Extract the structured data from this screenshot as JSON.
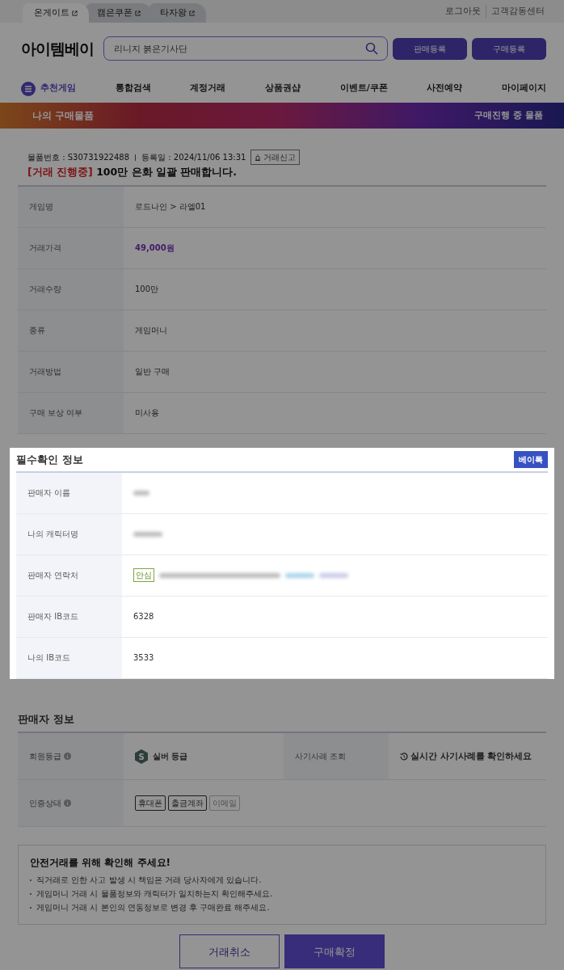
{
  "top_tabs": [
    {
      "label": "온게이트",
      "selected": true
    },
    {
      "label": "캠은쿠폰",
      "selected": false
    },
    {
      "label": "타자왕",
      "selected": false
    }
  ],
  "top_links": [
    "로그아웃",
    "고객감동센터"
  ],
  "logo": "아이템베이",
  "search": {
    "placeholder": "리니지 붉은기사단"
  },
  "header_buttons": [
    "판매등록",
    "구매등록"
  ],
  "nav": [
    {
      "label": "추천게임",
      "kind": "menu"
    },
    {
      "label": "통합검색",
      "kind": "link"
    },
    {
      "label": "계정거래",
      "kind": "link"
    },
    {
      "label": "상품권샵",
      "kind": "link"
    },
    {
      "label": "이벤트/쿠폰",
      "kind": "link"
    },
    {
      "label": "사전예약",
      "kind": "link"
    },
    {
      "label": "마이페이지",
      "kind": "link"
    }
  ],
  "banner": {
    "title": "나의 구매물품",
    "link": "구매진행 중 물품"
  },
  "item": {
    "number": "물품번호 : S30731922488",
    "date": "등록일 : 2024/11/06 13:31",
    "report": "거래신고",
    "status": "[거래 진행중]",
    "title": "100만 은화 일괄 판매합니다."
  },
  "details": [
    {
      "label": "게임명",
      "value": "로드나인 > 라엘01",
      "kind": "text"
    },
    {
      "label": "거래가격",
      "value": "49,000원",
      "kind": "price"
    },
    {
      "label": "거래수량",
      "value": "100만",
      "kind": "text"
    },
    {
      "label": "종류",
      "value": "게임머니",
      "kind": "text"
    },
    {
      "label": "거래방법",
      "value": "일반 구매",
      "kind": "text"
    },
    {
      "label": "구매 보상 여부",
      "value": "미사용",
      "kind": "text"
    }
  ],
  "required_info": {
    "title": "필수확인 정보",
    "badge": "베이톡",
    "rows": [
      {
        "label": "판매자 이름",
        "kind": "hidden"
      },
      {
        "label": "나의 캐릭터명",
        "kind": "hidden"
      },
      {
        "label": "판매자 연락처",
        "kind": "contact",
        "tag": "안심"
      },
      {
        "label": "판매자 IB코드",
        "kind": "text",
        "value": "6328"
      },
      {
        "label": "나의 IB코드",
        "kind": "text",
        "value": "3533"
      }
    ]
  },
  "seller_info": {
    "title": "판매자 정보",
    "grade_label": "회원등급",
    "grade_badge": "S",
    "grade": "실버 등급",
    "fraud_label": "사기사례 조회",
    "fraud_link": "실시간 사기사례를 확인하세요",
    "cert_label": "인증상태",
    "certs": [
      {
        "label": "휴대폰",
        "verified": true
      },
      {
        "label": "출금계좌",
        "verified": true
      },
      {
        "label": "이메일",
        "verified": false
      }
    ]
  },
  "notice": {
    "title": "안전거래를 위해 확인해 주세요!",
    "items": [
      "직거래로 인한 사고 발생 시 책임은 거래 당사자에게 있습니다.",
      "게임머니 거래 시 물품정보와 캐릭터가 일치하는지 확인해주세요.",
      "게임머니 거래 시 본인의 연동정보로 변경 후 구매완료 해주세요."
    ]
  },
  "actions": [
    {
      "label": "거래취소",
      "kind": "secondary"
    },
    {
      "label": "구매확정",
      "kind": "primary"
    }
  ]
}
